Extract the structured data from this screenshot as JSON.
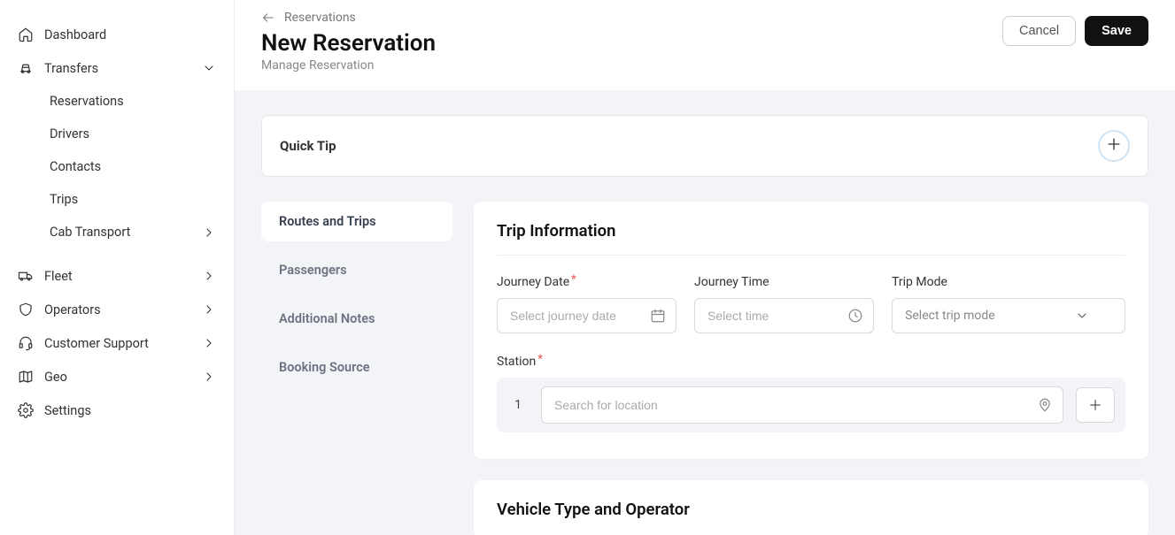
{
  "sidebar": {
    "dashboard": "Dashboard",
    "transfers": "Transfers",
    "transfers_sub": {
      "reservations": "Reservations",
      "drivers": "Drivers",
      "contacts": "Contacts",
      "trips": "Trips",
      "cab_transport": "Cab Transport"
    },
    "fleet": "Fleet",
    "operators": "Operators",
    "customer_support": "Customer Support",
    "geo": "Geo",
    "settings": "Settings"
  },
  "header": {
    "breadcrumb": "Reservations",
    "title": "New Reservation",
    "subtitle": "Manage Reservation",
    "cancel": "Cancel",
    "save": "Save"
  },
  "quick_tip": {
    "title": "Quick Tip"
  },
  "side_tabs": {
    "routes": "Routes and Trips",
    "passengers": "Passengers",
    "notes": "Additional Notes",
    "booking_source": "Booking Source"
  },
  "trip_info": {
    "panel_title": "Trip Information",
    "journey_date_label": "Journey Date",
    "journey_date_placeholder": "Select journey date",
    "journey_time_label": "Journey Time",
    "journey_time_placeholder": "Select time",
    "trip_mode_label": "Trip Mode",
    "trip_mode_placeholder": "Select trip mode",
    "station_label": "Station",
    "station_num": "1",
    "station_placeholder": "Search for location"
  },
  "vehicle_panel": {
    "title": "Vehicle Type and Operator"
  }
}
